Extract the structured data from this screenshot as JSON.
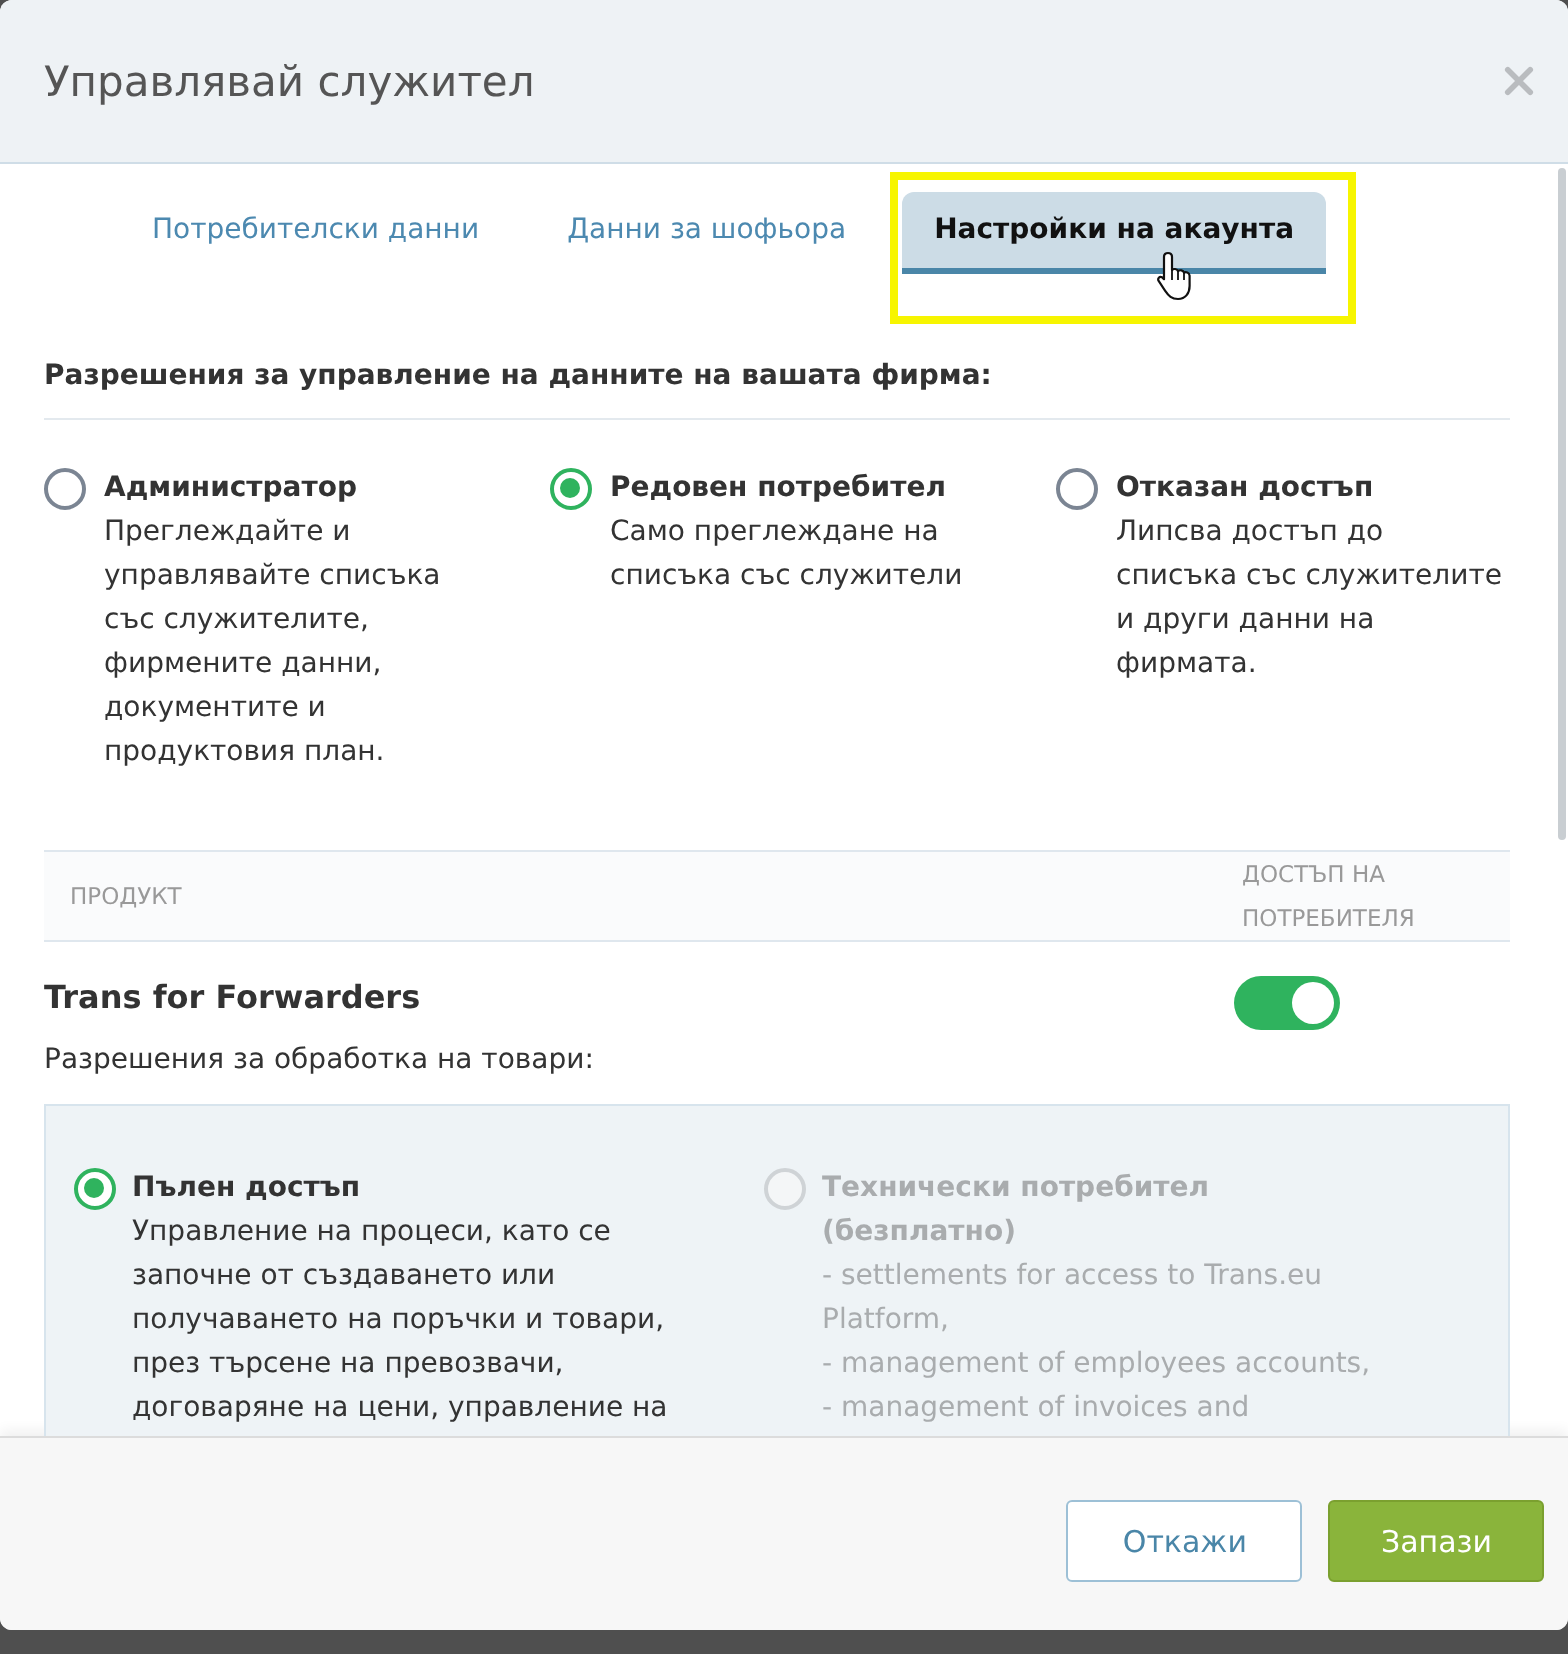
{
  "dialog": {
    "title": "Управлявай служител"
  },
  "tabs": [
    {
      "label": "Потребителски данни",
      "selected": false,
      "highlighted": false
    },
    {
      "label": "Данни за шофьора",
      "selected": false,
      "highlighted": false
    },
    {
      "label": "Настройки на акаунта",
      "selected": true,
      "highlighted": true
    }
  ],
  "company_permissions": {
    "heading": "Разрешения за управление на данните на вашата фирма:",
    "options": [
      {
        "title": "Администратор",
        "description": "Преглеждайте и управлявайте списъка със служителите, фирмените данни, документите и продуктовия план.",
        "selected": false
      },
      {
        "title": "Редовен потребител",
        "description": "Само преглеждане на списъка със служители",
        "selected": true
      },
      {
        "title": "Отказан достъп",
        "description": "Липсва достъп до списъка със служителите и други данни на фирмата.",
        "selected": false
      }
    ]
  },
  "products_table": {
    "columns": [
      "ПРОДУКТ",
      "ДОСТЪП НА ПОТРЕБИТЕЛЯ"
    ],
    "rows": [
      {
        "name": "Trans for Forwarders",
        "access_on": true,
        "permissions_label": "Разрешения за обработка на товари:",
        "options": [
          {
            "title": "Пълен достъп",
            "description": "Управление на процеси, като се започне от създаването или получаването на поръчки и товари, през търсене на превозвачи, договаряне на цени, управление на",
            "selected": true,
            "disabled": false
          },
          {
            "title": "Технически потребител (безплатно)",
            "details": [
              "- settlements for access to Trans.eu Platform,",
              "- management of employees accounts,",
              "- management of invoices and"
            ],
            "selected": false,
            "disabled": true
          }
        ]
      }
    ]
  },
  "footer": {
    "buttons": [
      {
        "label": "Откажи",
        "kind": "secondary"
      },
      {
        "label": "Запази",
        "kind": "primary"
      }
    ]
  }
}
